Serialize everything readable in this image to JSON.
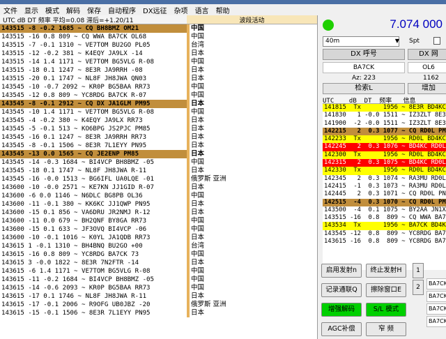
{
  "menu": [
    "文件",
    "显示",
    "模式",
    "解码",
    "保存",
    "自动程序",
    "DX远征",
    "杂项",
    "语言",
    "帮助"
  ],
  "left_header": {
    "cols": "UTC    dB   DT  频率   平均=0.08 滞后=+1.20/11",
    "activity": "波段活动"
  },
  "left_rows": [
    {
      "msg": "143515  -8 -0.2 1685 ~ CQ BH8BMZ OM21",
      "ctry": "中国",
      "cq": true
    },
    {
      "msg": "143515 -16  0.8  809 ~ CQ WWA BA7CK OL68",
      "ctry": "中国",
      "cq": false
    },
    {
      "msg": "143515  -7 -0.1 1310 ~ VE7TOM BU2GO PL05",
      "ctry": "台湾",
      "cq": false
    },
    {
      "msg": "143515 -12 -0.2  381 ~ K4EQY JA9LX -14",
      "ctry": "日本",
      "cq": false
    },
    {
      "msg": "143515 -14  1.4 1171 ~ VE7TOM BG5VLG R-08",
      "ctry": "中国",
      "cq": false
    },
    {
      "msg": "143515 -18  0.1 1247 ~ 8E3R JA9RRH -08",
      "ctry": "日本",
      "cq": false
    },
    {
      "msg": "143515 -20  0.1 1747 ~ NL8F JH8JWA QN03",
      "ctry": "日本",
      "cq": false
    },
    {
      "msg": "143545 -10 -0.7 2092 ~ KR0P BG5BAA RR73",
      "ctry": "中国",
      "cq": false
    },
    {
      "msg": "143545 -12  0.8  809 ~ YC8RDG BA7CK R-07",
      "ctry": "中国",
      "cq": false
    },
    {
      "msg": "143545  -8 -0.1 2912 ~ CQ DX JA1GLM PM95",
      "ctry": "日本",
      "cq": true
    },
    {
      "msg": "143545 -10  1.4 1171 ~ VE7TOM BG5VLG R-08",
      "ctry": "中国",
      "cq": false
    },
    {
      "msg": "143545  -4 -0.2  380 ~ K4EQY JA9LX RR73",
      "ctry": "日本",
      "cq": false
    },
    {
      "msg": "143545  -5 -0.1  513 ~ KO6BPG JS2PJC PM85",
      "ctry": "日本",
      "cq": false
    },
    {
      "msg": "143545 -16  0.1 1247 ~ 8E3R JA9RRH RR73",
      "ctry": "日本",
      "cq": false
    },
    {
      "msg": "143545  -8 -0.1 1506 ~ 8E3R 7L1EYY PN95",
      "ctry": "日本",
      "cq": false
    },
    {
      "msg": "143545 -13  0.0 1565 ~ CQ JE2ENP PM85",
      "ctry": "日本",
      "cq": true
    },
    {
      "msg": "143545 -14 -0.3 1684 ~ BI4VCP BH8BMZ -05",
      "ctry": "中国",
      "cq": false
    },
    {
      "msg": "143545 -18  0.1 1747 ~ NL8F JH8JWA R-11",
      "ctry": "日本",
      "cq": false
    },
    {
      "msg": "143545 -16 -0.0 1513 ~ BG6IFL UA0LQE -01",
      "ctry": "俄罗斯 亚洲",
      "cq": false
    },
    {
      "msg": "143600 -10 -0.0 2571 ~ KE7KN JJ1GID R-07",
      "ctry": "日本",
      "cq": false
    },
    {
      "msg": "143600  -6  0.0 1146 ~ N6DLC BG8PB OL36",
      "ctry": "中国",
      "cq": false
    },
    {
      "msg": "143600 -11 -0.1  380 ~ KK6KC JJ1QWP PN95",
      "ctry": "日本",
      "cq": false
    },
    {
      "msg": "143600 -15  0.1  856 ~ VA6DRU JR2NMJ R-12",
      "ctry": "日本",
      "cq": false
    },
    {
      "msg": "143600 -11  0.0  679 ~ BH2QNF BY8GA RR73",
      "ctry": "中国",
      "cq": false
    },
    {
      "msg": "143600 -15  0.1  633 ~ JF3OVQ BI4VCP -06",
      "ctry": "中国",
      "cq": false
    },
    {
      "msg": "143600 -10 -0.1 1016 ~ K0YL JA1QDB RR73",
      "ctry": "日本",
      "cq": false
    },
    {
      "msg": "143615   1 -0.1 1310 ~ BH4BNQ BU2GO +00",
      "ctry": "台湾",
      "cq": false
    },
    {
      "msg": "143615 -16  0.8  809 ~ YC8RDG BA7CK 73",
      "ctry": "中国",
      "cq": false
    },
    {
      "msg": "143615   3 -0.0 1822 ~ 8E3R 7N2FTR -14",
      "ctry": "日本",
      "cq": false
    },
    {
      "msg": "143615  -6  1.4 1171 ~ VE7TOM BG5VLG R-08",
      "ctry": "中国",
      "cq": false
    },
    {
      "msg": "143615 -11 -0.2 1684 ~ BI4VCP BH8BMZ -05",
      "ctry": "中国",
      "cq": false
    },
    {
      "msg": "143615 -14 -0.6 2093 ~ KR0P BG5BAA RR73",
      "ctry": "中国",
      "cq": false
    },
    {
      "msg": "143615 -17  0.1 1746 ~ NL8F JH8JWA R-11",
      "ctry": "日本",
      "cq": false
    },
    {
      "msg": "143615 -17 -0.1 2006 ~ R9OFG UB0JBZ -20",
      "ctry": "俄罗斯 亚洲",
      "cq": false
    },
    {
      "msg": "143615 -15 -0.1 1506 ~ 8E3R 7L1EYY PN95",
      "ctry": "日本",
      "cq": false
    }
  ],
  "freq": "7.074 000",
  "band": "40m",
  "band_arrow": "▼",
  "spt_label": "Spt",
  "dx_call_label": "DX 呼号",
  "dx_grid_label": "DX 网",
  "dx_call_value": "BA7CK",
  "dx_grid_value": "OL6",
  "az": "Az: 223",
  "dist": "1162",
  "lookup_label": "检索L",
  "add_label": "增加",
  "right_header": "UTC    dB  DT  频率   信息",
  "right_rows": [
    {
      "t": "141815  Tx      1956 ~ 8E3R BD4KC",
      "c": "y"
    },
    {
      "t": "141830   1 -0.0 1511 ~ IZ3ZLT 8E3",
      "c": ""
    },
    {
      "t": "141900  -2 -0.0 1511 ~ IZ3ZLT 8E3",
      "c": ""
    },
    {
      "t": "142215   2  0.3 1077 ~ CQ RD0L PM",
      "c": "g"
    },
    {
      "t": "142233  Tx      1956 ~ RD0L BD4KC",
      "c": "y"
    },
    {
      "t": "142245   2  0.3 1076 ~ BD4KC RD0L",
      "c": "r"
    },
    {
      "t": "142300  Tx      1956 ~ RD0L BD4KC",
      "c": "y"
    },
    {
      "t": "142315   2  0.3 1075 ~ BD4KC RD0L",
      "c": "r"
    },
    {
      "t": "142330  Tx      1956 ~ RD0L BD4KC",
      "c": "y"
    },
    {
      "t": "142345   2  0.3 1074 ~ RA3MU RD0L",
      "c": ""
    },
    {
      "t": "142415  -1  0.3 1073 ~ RA3MU RD0L",
      "c": ""
    },
    {
      "t": "142445   2  0.3 1071 ~ CQ RD0L PN",
      "c": ""
    },
    {
      "t": "142515  -4  0.3 1070 ~ CQ RD0L PM",
      "c": "g"
    },
    {
      "t": "143500  -4  0.1 1075 ~ BY2AA JN1X",
      "c": ""
    },
    {
      "t": "143515 -16  0.8  809 ~ CQ WWA BA7",
      "c": ""
    },
    {
      "t": "143534  Tx      1956 ~ BA7CK BD4KC",
      "c": "y"
    },
    {
      "t": "143545 -12  0.8  809 ~ YC8RDG BA7",
      "c": ""
    },
    {
      "t": "143615 -16  0.8  809 ~ YC8RDG BA7",
      "c": ""
    }
  ],
  "buttons": {
    "enable_tx": "启用发射n",
    "halt_tx": "终止发射H",
    "log_qso": "记录通联Q",
    "erase": "擦除窗口E",
    "enh_decode": "增强解码",
    "sl_mode": "S/L 模式",
    "agc": "AGC补偿",
    "narrow": "窄 频"
  },
  "tabs": [
    "1",
    "2"
  ],
  "tab_cells": [
    "BA7CK",
    "BA7CK",
    "BA7CK",
    "BA7CK"
  ]
}
